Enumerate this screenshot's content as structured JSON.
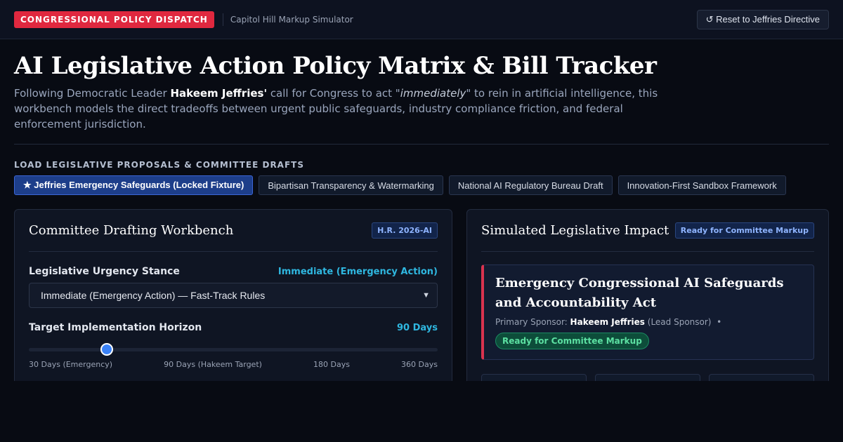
{
  "topbar": {
    "brand": "CONGRESSIONAL POLICY DISPATCH",
    "subtitle": "Capitol Hill Markup Simulator",
    "reset_label": "↺ Reset to Jeffries Directive"
  },
  "page": {
    "title": "AI Legislative Action Policy Matrix & Bill Tracker",
    "desc_prefix": "Following Democratic Leader ",
    "desc_name": "Hakeem Jeffries'",
    "desc_mid": " call for Congress to act \"",
    "desc_emph": "immediately",
    "desc_suffix": "\" to rein in artificial intelligence, this workbench models the direct tradeoffs between urgent public safeguards, industry compliance friction, and federal enforcement jurisdiction."
  },
  "proposals": {
    "section_label": "LOAD LEGISLATIVE PROPOSALS & COMMITTEE DRAFTS",
    "items": [
      {
        "label": "★ Jeffries Emergency Safeguards (Locked Fixture)",
        "active": true
      },
      {
        "label": "Bipartisan Transparency & Watermarking",
        "active": false
      },
      {
        "label": "National AI Regulatory Bureau Draft",
        "active": false
      },
      {
        "label": "Innovation-First Sandbox Framework",
        "active": false
      }
    ]
  },
  "workbench": {
    "title": "Committee Drafting Workbench",
    "tag": "H.R. 2026-AI",
    "urgency_label": "Legislative Urgency Stance",
    "urgency_value": "Immediate (Emergency Action)",
    "urgency_selected": "Immediate (Emergency Action) — Fast-Track Rules",
    "horizon_label": "Target Implementation Horizon",
    "horizon_value": "90 Days",
    "horizon_fraction": 0.19,
    "ticks": [
      "30 Days (Emergency)",
      "90 Days (Hakeem Target)",
      "180 Days",
      "360 Days"
    ]
  },
  "impact": {
    "title": "Simulated Legislative Impact",
    "tag": "Ready for Committee Markup",
    "bill_title": "Emergency Congressional AI Safeguards and Accountability Act",
    "sponsor_prefix": "Primary Sponsor: ",
    "sponsor_name": "Hakeem Jeffries",
    "sponsor_role": " (Lead Sponsor)",
    "sponsor_sep": "•",
    "status": "Ready for Committee Markup"
  },
  "colors": {
    "accent_red": "#e0283f",
    "accent_blue": "#3b82f6",
    "value_cyan": "#2fb7e0",
    "status_green": "#5ce0a2"
  }
}
